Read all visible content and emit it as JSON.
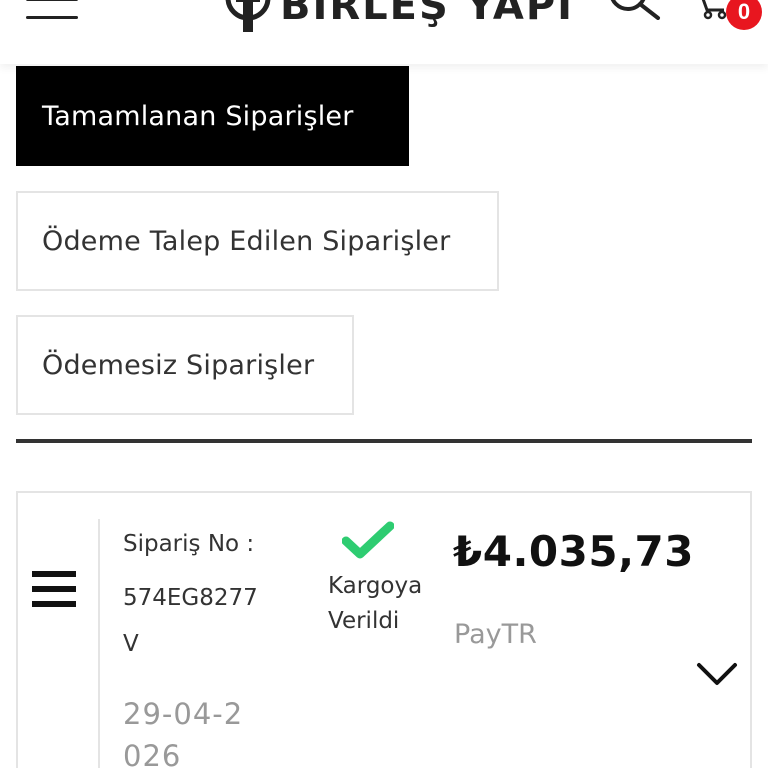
{
  "header": {
    "logo_text": "BIRLEŞ YAPI",
    "cart_count": "0"
  },
  "tabs": [
    {
      "label": "Tamamlanan Siparişler",
      "active": true
    },
    {
      "label": "Ödeme Talep Edilen Siparişler",
      "active": false
    },
    {
      "label": "Ödemesiz Siparişler",
      "active": false
    }
  ],
  "order": {
    "order_no_label": "Sipariş No :",
    "order_no": "574EG8277V",
    "status": "Kargoya Verildi",
    "price": "₺4.035,73",
    "payment_method": "PayTR",
    "date": "29-04-2026"
  },
  "colors": {
    "accent_active_tab": "#000000",
    "status_check": "#2ecc71",
    "badge": "#e8161f"
  }
}
